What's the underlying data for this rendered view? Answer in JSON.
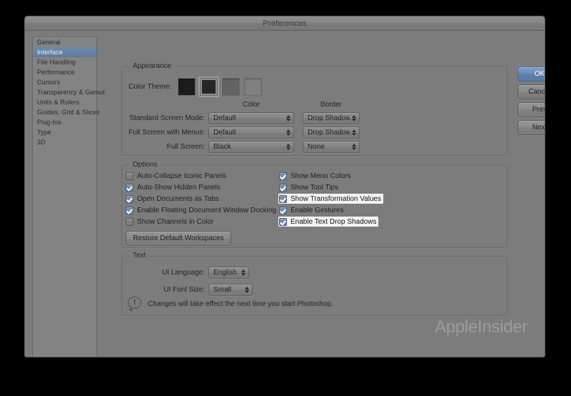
{
  "window": {
    "title": "Preferences"
  },
  "sidebar": {
    "items": [
      {
        "label": "General",
        "selected": false
      },
      {
        "label": "Interface",
        "selected": true
      },
      {
        "label": "File Handling",
        "selected": false
      },
      {
        "label": "Performance",
        "selected": false
      },
      {
        "label": "Cursors",
        "selected": false
      },
      {
        "label": "Transparency & Gamut",
        "selected": false
      },
      {
        "label": "Units & Rulers",
        "selected": false
      },
      {
        "label": "Guides, Grid & Slices",
        "selected": false
      },
      {
        "label": "Plug-Ins",
        "selected": false
      },
      {
        "label": "Type",
        "selected": false
      },
      {
        "label": "3D",
        "selected": false
      }
    ]
  },
  "appearance": {
    "legend": "Appearance",
    "color_theme_label": "Color Theme:",
    "swatches": [
      {
        "color": "#1b1b1b",
        "selected": false
      },
      {
        "color": "#262626",
        "selected": true
      },
      {
        "color": "#636363",
        "selected": false
      },
      {
        "color": "#808080",
        "selected": false
      }
    ],
    "column_headers": {
      "color": "Color",
      "border": "Border"
    },
    "rows": [
      {
        "label": "Standard Screen Mode:",
        "color": "Default",
        "border": "Drop Shadow"
      },
      {
        "label": "Full Screen with Menus:",
        "color": "Default",
        "border": "Drop Shadow"
      },
      {
        "label": "Full Screen:",
        "color": "Black",
        "border": "None"
      }
    ]
  },
  "options": {
    "legend": "Options",
    "left_column": [
      {
        "label": "Auto-Collapse Iconic Panels",
        "checked": false,
        "highlighted": false
      },
      {
        "label": "Auto-Show Hidden Panels",
        "checked": true,
        "highlighted": false
      },
      {
        "label": "Open Documents as Tabs",
        "checked": true,
        "highlighted": false
      },
      {
        "label": "Enable Floating Document Window Docking",
        "checked": true,
        "highlighted": false
      },
      {
        "label": "Show Channels in Color",
        "checked": false,
        "highlighted": false
      }
    ],
    "right_column": [
      {
        "label": "Show Menu Colors",
        "checked": true,
        "highlighted": false
      },
      {
        "label": "Show Tool Tips",
        "checked": true,
        "highlighted": false
      },
      {
        "label": "Show Transformation Values",
        "checked": true,
        "highlighted": true
      },
      {
        "label": "Enable Gestures",
        "checked": true,
        "highlighted": false
      },
      {
        "label": "Enable Text Drop Shadows",
        "checked": true,
        "highlighted": true
      }
    ],
    "restore_button": "Restore Default Workspaces"
  },
  "text_section": {
    "legend": "Text",
    "ui_language_label": "UI Language:",
    "ui_language_value": "English",
    "ui_font_size_label": "UI Font Size:",
    "ui_font_size_value": "Small",
    "notice_icon": "alert-exclamation-icon",
    "notice": "Changes will take effect the next time you start Photoshop."
  },
  "buttons": {
    "ok": "OK",
    "cancel": "Cancel",
    "prev": "Prev",
    "next": "Next"
  },
  "watermark": "AppleInsider",
  "colors": {
    "window_bg": "#7c7c7c",
    "titlebar": "#868686",
    "selection_blue": "#5f7b9c",
    "checkbox_blue": "#6b83a2",
    "highlight_white": "#f3f3f3",
    "default_button_blue": "#6d8cb6"
  }
}
